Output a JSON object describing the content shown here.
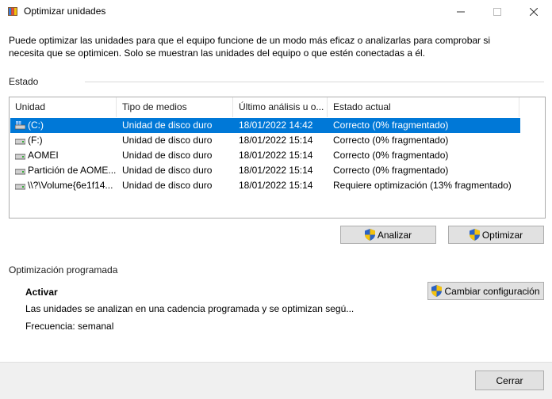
{
  "window": {
    "title": "Optimizar unidades",
    "controls": {
      "minimize": "—",
      "maximize": "☐",
      "close": "✕"
    }
  },
  "description": "Puede optimizar las unidades para que el equipo funcione de un modo más eficaz o analizarlas para comprobar si necesita que se optimicen. Solo se muestran las unidades del equipo o que estén conectadas a él.",
  "estado": {
    "label": "Estado",
    "columns": [
      "Unidad",
      "Tipo de medios",
      "Último análisis u o...",
      "Estado actual"
    ],
    "rows": [
      {
        "unit": "(C:)",
        "media": "Unidad de disco duro",
        "last": "18/01/2022 14:42",
        "status": "Correcto (0% fragmentado)",
        "selected": true,
        "icon": "system-drive-icon"
      },
      {
        "unit": "(F:)",
        "media": "Unidad de disco duro",
        "last": "18/01/2022 15:14",
        "status": "Correcto (0% fragmentado)",
        "selected": false,
        "icon": "drive-icon"
      },
      {
        "unit": "AOMEI",
        "media": "Unidad de disco duro",
        "last": "18/01/2022 15:14",
        "status": "Correcto (0% fragmentado)",
        "selected": false,
        "icon": "drive-icon"
      },
      {
        "unit": "Partición de AOME...",
        "media": "Unidad de disco duro",
        "last": "18/01/2022 15:14",
        "status": "Correcto (0% fragmentado)",
        "selected": false,
        "icon": "drive-icon"
      },
      {
        "unit": "\\\\?\\Volume{6e1f14...",
        "media": "Unidad de disco duro",
        "last": "18/01/2022 15:14",
        "status": "Requiere optimización (13% fragmentado)",
        "selected": false,
        "icon": "drive-icon"
      }
    ]
  },
  "actions": {
    "analizar": "Analizar",
    "optimizar": "Optimizar"
  },
  "programada": {
    "label": "Optimización programada",
    "status": "Activar",
    "description": "Las unidades se analizan en una cadencia programada y se optimizan segú...",
    "frequency": "Frecuencia: semanal",
    "change_button": "Cambiar configuración"
  },
  "footer": {
    "close_button": "Cerrar"
  },
  "colors": {
    "selection": "#0078d7",
    "button_bg": "#e1e1e1",
    "footer_bg": "#f0f0f0"
  }
}
